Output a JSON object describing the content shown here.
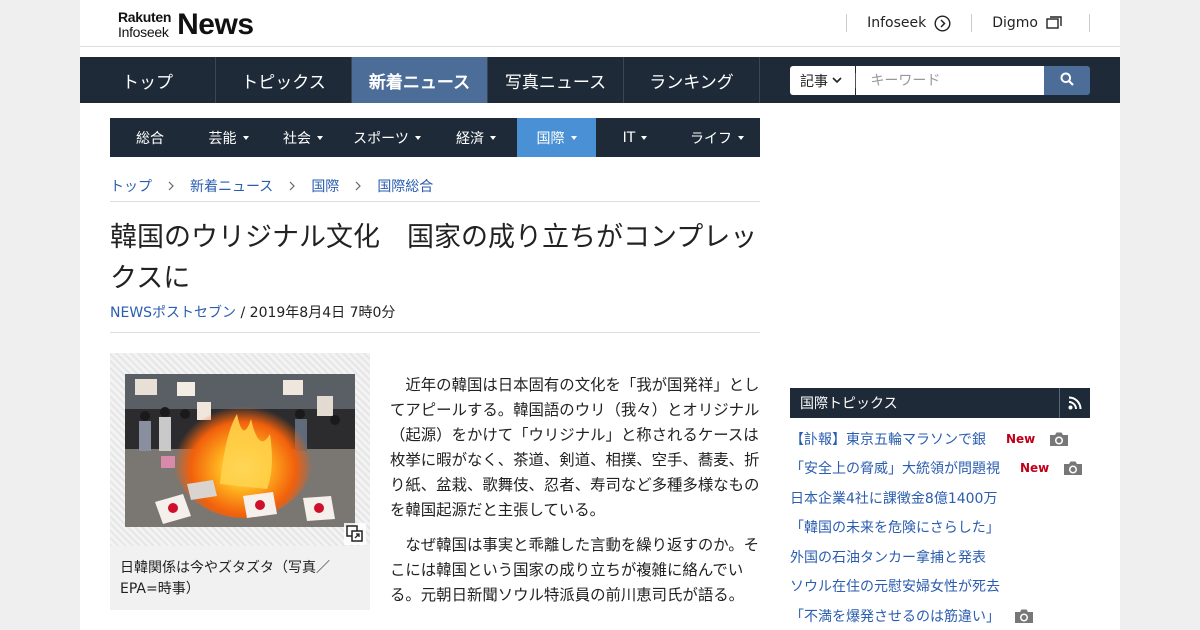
{
  "header": {
    "logo_rakuten": "Rakuten",
    "logo_infoseek": "Infoseek",
    "logo_news": "News",
    "links": [
      {
        "label": "Infoseek",
        "icon": "circle-arrow-icon"
      },
      {
        "label": "Digmo",
        "icon": "window-stack-icon"
      }
    ]
  },
  "global_nav": {
    "items": [
      "トップ",
      "トピックス",
      "新着ニュース",
      "写真ニュース",
      "ランキング"
    ],
    "active_index": 2
  },
  "search": {
    "select_label": "記事",
    "placeholder": "キーワード",
    "button_icon": "search-icon"
  },
  "category_nav": {
    "items": [
      "総合",
      "芸能",
      "社会",
      "スポーツ",
      "経済",
      "国際",
      "IT",
      "ライフ"
    ],
    "active_index": 5,
    "accent_color": "#4a90d4"
  },
  "breadcrumb": [
    "トップ",
    "新着ニュース",
    "国際",
    "国際総合"
  ],
  "article": {
    "title": "韓国のウリジナル文化　国家の成り立ちがコンプレックスに",
    "source": "NEWSポストセブン",
    "date": " / 2019年8月4日 7時0分",
    "caption": "日韓関係は今やズタズタ（写真／EPA=時事）",
    "paragraphs": [
      "近年の韓国は日本固有の文化を「我が国発祥」としてアピールする。韓国語のウリ（我々）とオリジナル（起源）をかけて「ウリジナル」と称されるケースは枚挙に暇がなく、茶道、剣道、相撲、空手、蕎麦、折り紙、盆栽、歌舞伎、忍者、寿司など多種多様なものを韓国起源だと主張している。",
      "なぜ韓国は事実と乖離した言動を繰り返すのか。そこには韓国という国家の成り立ちが複雑に絡んでいる。元朝日新聞ソウル特派員の前川恵司氏が語る。"
    ]
  },
  "sidebar": {
    "title": "国際トピックス",
    "topics": [
      {
        "text": "【訃報】東京五輪マラソンで銀",
        "new": "New",
        "camera": true
      },
      {
        "text": "「安全上の脅威」大統領が問題視",
        "new": "New",
        "camera": true
      },
      {
        "text": "日本企業4社に課徴金8億1400万",
        "new": "",
        "camera": false
      },
      {
        "text": "「韓国の未来を危険にさらした」",
        "new": "",
        "camera": false
      },
      {
        "text": "外国の石油タンカー拿捕と発表",
        "new": "",
        "camera": false
      },
      {
        "text": "ソウル在住の元慰安婦女性が死去",
        "new": "",
        "camera": false
      },
      {
        "text": "「不満を爆発させるのは筋違い」",
        "new": "",
        "camera": true
      }
    ]
  }
}
